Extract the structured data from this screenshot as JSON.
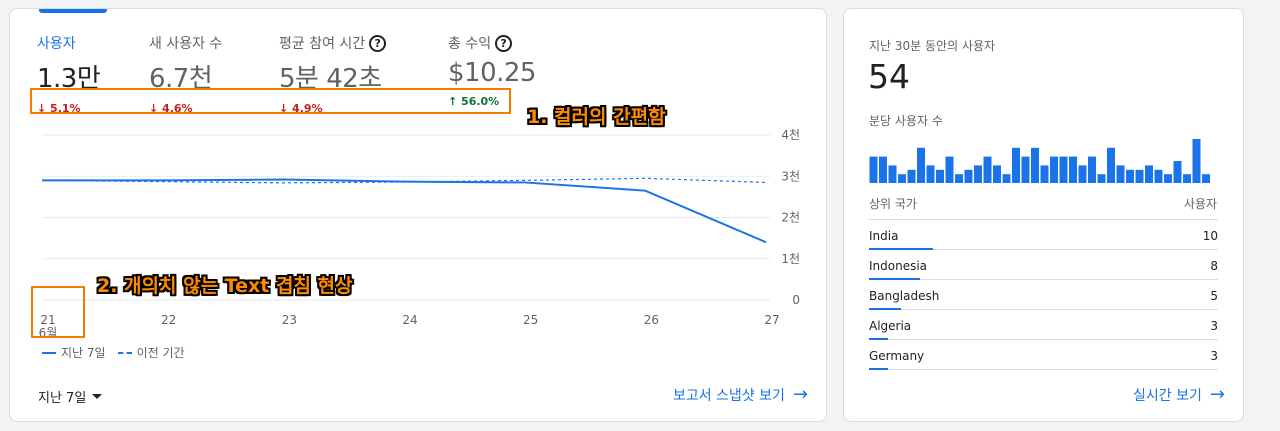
{
  "metrics": [
    {
      "label": "사용자",
      "value": "1.3만",
      "change": "↓ 5.1%",
      "trend": "down",
      "help": false
    },
    {
      "label": "새 사용자 수",
      "value": "6.7천",
      "change": "↓ 4.6%",
      "trend": "down",
      "help": false
    },
    {
      "label": "평균 참여 시간",
      "value": "5분 42초",
      "change": "↓ 4.9%",
      "trend": "down",
      "help": true
    },
    {
      "label": "총 수익",
      "value": "$10.25",
      "change": "↑ 56.0%",
      "trend": "up",
      "help": true
    }
  ],
  "help_glyph": "?",
  "annotations": {
    "one": "1. 컬러의 간편함",
    "two": "2. 개의치 않는 Text 겹침 현상"
  },
  "chart_data": {
    "type": "line",
    "x": [
      "21",
      "22",
      "23",
      "24",
      "25",
      "26",
      "27"
    ],
    "x_sublabel": "6월",
    "y_ticks": [
      "4천",
      "3천",
      "2천",
      "1천",
      "0"
    ],
    "ylim": [
      0,
      4000
    ],
    "series": [
      {
        "name": "지난 7일",
        "style": "solid",
        "values": [
          2900,
          2900,
          2920,
          2870,
          2850,
          2650,
          1400
        ]
      },
      {
        "name": "이전 기간",
        "style": "dashed",
        "values": [
          2900,
          2870,
          2840,
          2860,
          2900,
          2950,
          2850
        ]
      }
    ],
    "color": "#1a73e8",
    "grid": true
  },
  "legend": {
    "current": "지난 7일",
    "previous": "이전 기간"
  },
  "date_range": "지난 7일",
  "report_link": "보고서 스냅샷 보기",
  "arrow_glyph": "→",
  "realtime": {
    "title": "지난 30분 동안의 사용자",
    "count": "54",
    "per_minute_label": "분당 사용자 수",
    "per_minute": [
      6,
      6,
      4,
      2,
      3,
      8,
      4,
      3,
      6,
      2,
      3,
      4,
      6,
      4,
      2,
      8,
      6,
      8,
      4,
      6,
      6,
      6,
      4,
      6,
      2,
      8,
      4,
      3,
      3,
      4,
      3,
      2,
      5,
      2,
      10,
      2
    ],
    "table_headers": {
      "country": "상위 국가",
      "users": "사용자"
    },
    "countries": [
      {
        "name": "India",
        "value": "10",
        "share": 1.0
      },
      {
        "name": "Indonesia",
        "value": "8",
        "share": 0.8
      },
      {
        "name": "Bangladesh",
        "value": "5",
        "share": 0.5
      },
      {
        "name": "Algeria",
        "value": "3",
        "share": 0.3
      },
      {
        "name": "Germany",
        "value": "3",
        "share": 0.3
      }
    ],
    "link": "실시간 보기"
  }
}
